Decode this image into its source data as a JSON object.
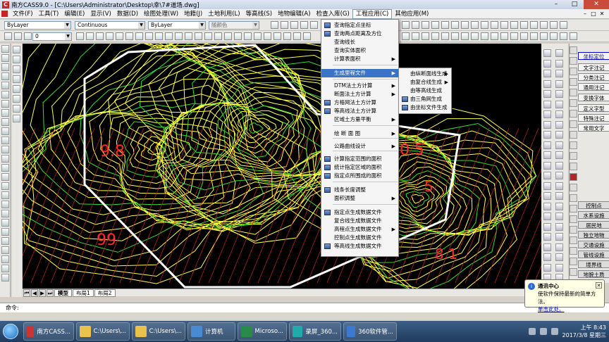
{
  "window": {
    "title": "南方CASS9.0 - [C:\\Users\\Administrator\\Desktop\\幸\\7#道场.dwg]",
    "controls": [
      "–",
      "□",
      "✕"
    ]
  },
  "menubar": {
    "items": [
      "文件(F)",
      "工具(T)",
      "编辑(E)",
      "显示(V)",
      "数据(D)",
      "绘图处理(W)",
      "地籍(J)",
      "土地利用(L)",
      "等高线(S)",
      "地物编辑(A)",
      "检查入库(G)",
      "工程应用(C)",
      "其他应用(M)"
    ],
    "active_index": 11,
    "mdi_controls": [
      "–",
      "□",
      "✕"
    ]
  },
  "toolbar": {
    "layer_combo": "ByLayer",
    "linetype_combo": "Continuous",
    "lineweight_combo": "ByLayer",
    "color_combo": "随颜色",
    "layer_state_combo": "0"
  },
  "engineering_menu": {
    "items": [
      {
        "label": "查询指定点坐标",
        "icon": true,
        "submenu": false
      },
      {
        "label": "查询两点距离及方位",
        "icon": true,
        "submenu": false
      },
      {
        "label": "查询线长",
        "icon": false,
        "submenu": false
      },
      {
        "label": "查询实体面积",
        "icon": false,
        "submenu": false
      },
      {
        "label": "计算表面积",
        "icon": false,
        "submenu": true
      },
      {
        "label": "生成里程文件",
        "icon": false,
        "submenu": true,
        "highlighted": true
      },
      {
        "label": "DTM法土方计算",
        "icon": false,
        "submenu": true
      },
      {
        "label": "断面法土方计算",
        "icon": false,
        "submenu": true
      },
      {
        "label": "方格网法土方计算",
        "icon": true,
        "submenu": false
      },
      {
        "label": "等高线法土方计算",
        "icon": true,
        "submenu": false
      },
      {
        "label": "区域土方量平衡",
        "icon": false,
        "submenu": true
      },
      {
        "label": "绘 断 面 图",
        "icon": false,
        "submenu": true
      },
      {
        "label": "公路曲线设计",
        "icon": false,
        "submenu": true
      },
      {
        "label": "计算指定范围的面积",
        "icon": true,
        "submenu": false
      },
      {
        "label": "统计指定区域的面积",
        "icon": true,
        "submenu": false
      },
      {
        "label": "指定点所围成的面积",
        "icon": true,
        "submenu": false
      },
      {
        "label": "线条长度调整",
        "icon": true,
        "submenu": false
      },
      {
        "label": "面积调整",
        "icon": false,
        "submenu": true
      },
      {
        "label": "指定点生成数据文件",
        "icon": true,
        "submenu": false
      },
      {
        "label": "复合线生成数据文件",
        "icon": false,
        "submenu": false
      },
      {
        "label": "高程点生成数据文件",
        "icon": false,
        "submenu": true
      },
      {
        "label": "控制点生成数据文件",
        "icon": false,
        "submenu": false
      },
      {
        "label": "等高线生成数据文件",
        "icon": true,
        "submenu": false
      }
    ]
  },
  "mileage_submenu": {
    "items": [
      {
        "label": "由纵断面线生成",
        "icon": false,
        "submenu": true
      },
      {
        "label": "由复合线生成",
        "icon": false,
        "submenu": true
      },
      {
        "label": "由等高线生成",
        "icon": false,
        "submenu": false
      },
      {
        "label": "由三角网生成",
        "icon": true,
        "submenu": false
      },
      {
        "label": "由坐标文件生成",
        "icon": true,
        "submenu": false
      }
    ]
  },
  "cass_panel": {
    "buttons": [
      "坐标定位",
      "文字注记",
      "分类注记",
      "通用注记",
      "变换字体",
      "定义字型",
      "特殊注记",
      "常用文字",
      "控制点",
      "水系设施",
      "居民地",
      "独立地物",
      "交通设施",
      "管线设施",
      "境界线",
      "地貌土质"
    ],
    "selected_index": 0
  },
  "layout_tabs": [
    "模型",
    "布局1",
    "布局2"
  ],
  "command_line": {
    "prompt": "命令:"
  },
  "canvas_labels": [
    {
      "text": "0.5",
      "color": "#ff2a2a"
    },
    {
      "text": "5",
      "color": "#ff2a2a"
    },
    {
      "text": "99",
      "color": "#ff2a2a"
    },
    {
      "text": "8.1",
      "color": "#ff2a2a"
    },
    {
      "text": "9.8",
      "color": "#ff2a2a"
    }
  ],
  "notification": {
    "title": "通讯中心",
    "body": "使软件保持最新的简单方法。",
    "link": "单击此处。",
    "close": "✕"
  },
  "taskbar": {
    "items": [
      {
        "label": "南方CASS..."
      },
      {
        "label": "C:\\Users\\..."
      },
      {
        "label": "C:\\Users\\..."
      },
      {
        "label": "计算机"
      },
      {
        "label": "Microso..."
      },
      {
        "label": "录屏_360..."
      },
      {
        "label": "360软件管..."
      }
    ],
    "clock_time": "上午 8:43",
    "clock_date": "2017/3/8 星期三"
  }
}
